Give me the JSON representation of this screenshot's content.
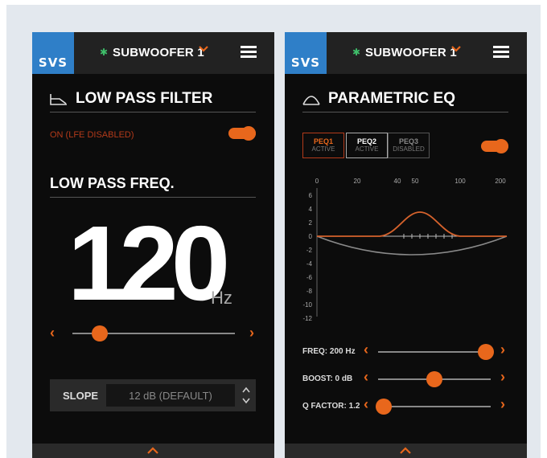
{
  "brand": "SVS",
  "device": {
    "name": "SUBWOOFER 1"
  },
  "left_panel": {
    "section_title": "LOW PASS FILTER",
    "toggle_label": "ON (LFE DISABLED)",
    "freq_title": "LOW PASS FREQ.",
    "freq_value": "120",
    "freq_unit": "Hz",
    "slider_fraction": 0.17,
    "slope": {
      "label": "SLOPE",
      "value": "12 dB (DEFAULT)"
    }
  },
  "right_panel": {
    "section_title": "PARAMETRIC EQ",
    "tabs": [
      {
        "name": "PEQ1",
        "status": "ACTIVE"
      },
      {
        "name": "PEQ2",
        "status": "ACTIVE"
      },
      {
        "name": "PEQ3",
        "status": "DISABLED"
      }
    ],
    "graph": {
      "x_ticks": [
        "0",
        "20",
        "40",
        "50",
        "100",
        "200"
      ],
      "y_ticks": [
        "6",
        "4",
        "2",
        "0",
        "-2",
        "-4",
        "-6",
        "-8",
        "-10",
        "-12"
      ]
    },
    "controls": [
      {
        "label": "FREQ: 200 Hz",
        "fraction": 0.96
      },
      {
        "label": "BOOST: 0 dB",
        "fraction": 0.5
      },
      {
        "label": "Q FACTOR: 1.2",
        "fraction": 0.05
      }
    ]
  },
  "colors": {
    "accent": "#e8671c",
    "brand_blue": "#2f7fc8",
    "bluetooth": "#3fbf6a"
  }
}
